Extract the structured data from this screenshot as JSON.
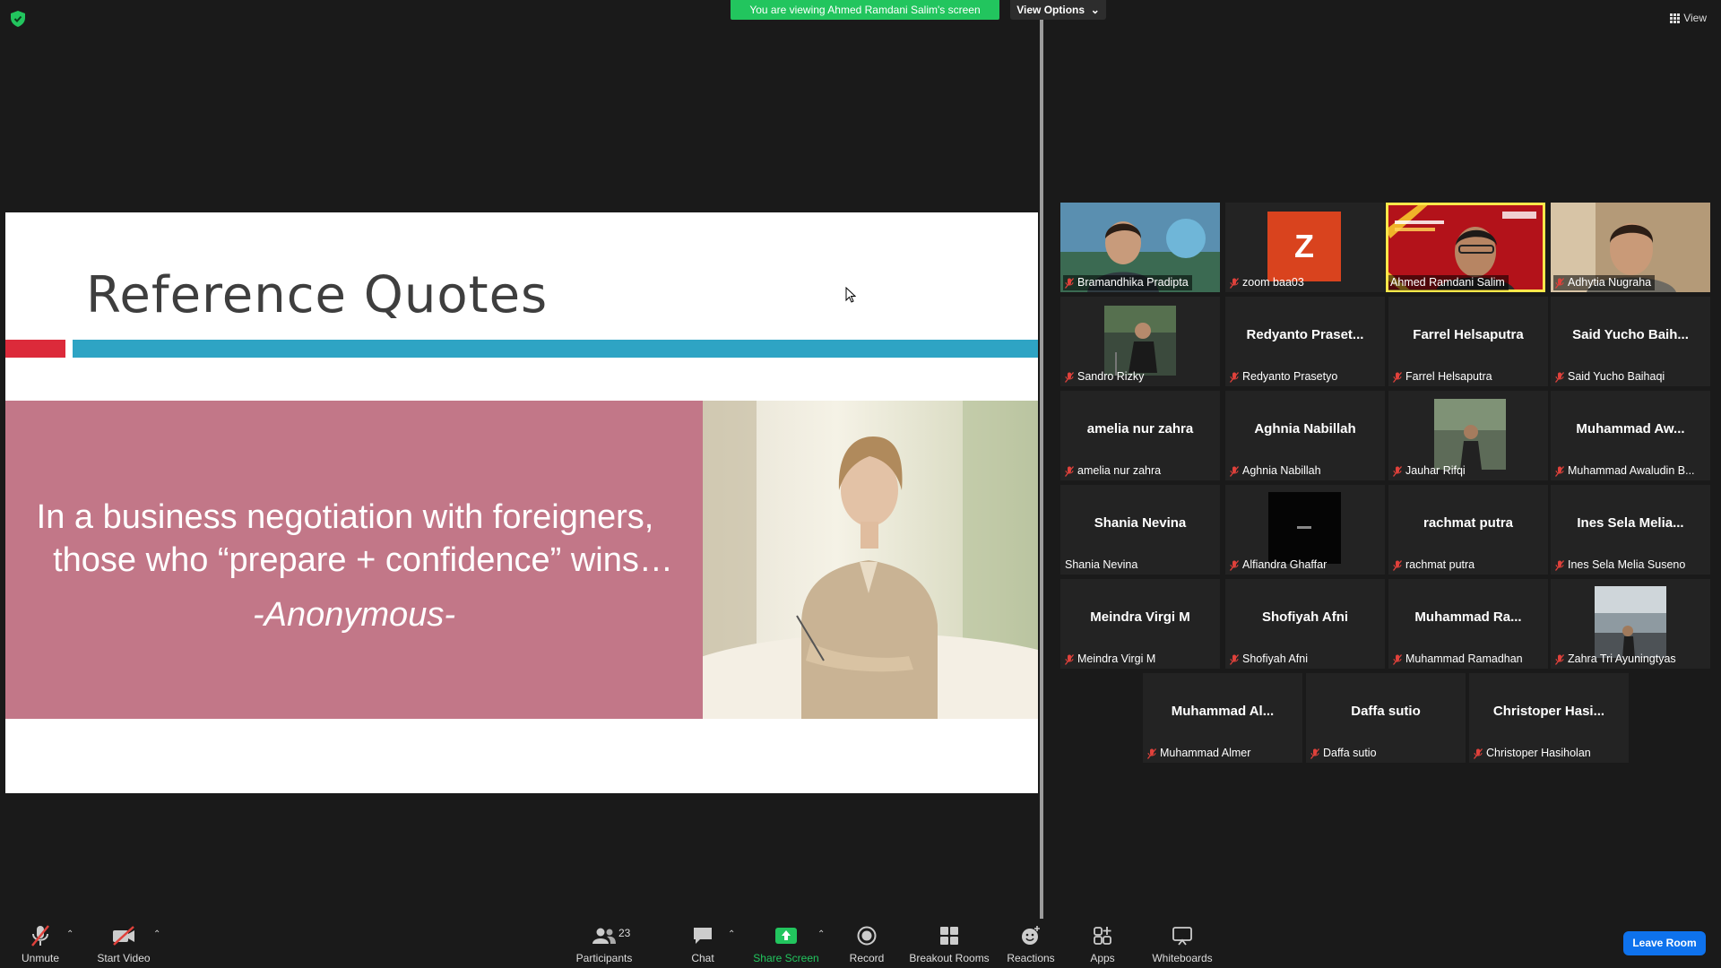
{
  "top_bar": {
    "viewing_banner": "You are viewing Ahmed Ramdani Salim's screen",
    "view_options_label": "View Options",
    "view_label": "View"
  },
  "slide": {
    "title": "Reference Quotes",
    "quote_line1": "In a business negotiation with foreigners,",
    "quote_line2": "those who “prepare + confidence” wins…",
    "quote_author": "-Anonymous-",
    "colors": {
      "red_bar": "#dc2a3a",
      "blue_bar": "#2ea4c4",
      "quote_panel": "#c27788"
    }
  },
  "gallery": {
    "active_speaker": "Ahmed Ramdani Salim",
    "rows": [
      [
        {
          "tile_name": "",
          "label": "Bramandhika Pradipta",
          "media": "video"
        },
        {
          "tile_name": "",
          "label": "zoom baa03",
          "media": "avatar",
          "avatar_letter": "Z"
        },
        {
          "tile_name": "",
          "label": "Ahmed Ramdani Salim",
          "media": "video"
        },
        {
          "tile_name": "",
          "label": "Adhytia Nugraha",
          "media": "video"
        }
      ],
      [
        {
          "tile_name": "",
          "label": "Sandro Rizky",
          "media": "photo"
        },
        {
          "tile_name": "Redyanto Praset...",
          "label": "Redyanto Prasetyo",
          "media": "name"
        },
        {
          "tile_name": "Farrel Helsaputra",
          "label": "Farrel Helsaputra",
          "media": "name"
        },
        {
          "tile_name": "Said Yucho Baih...",
          "label": "Said Yucho Baihaqi",
          "media": "name"
        }
      ],
      [
        {
          "tile_name": "amelia nur zahra",
          "label": "amelia nur zahra",
          "media": "name"
        },
        {
          "tile_name": "Aghnia Nabillah",
          "label": "Aghnia Nabillah",
          "media": "name"
        },
        {
          "tile_name": "",
          "label": "Jauhar Rifqi",
          "media": "photo"
        },
        {
          "tile_name": "Muhammad Aw...",
          "label": "Muhammad Awaludin B...",
          "media": "name"
        }
      ],
      [
        {
          "tile_name": "Shania Nevina",
          "label": "Shania Nevina",
          "media": "name"
        },
        {
          "tile_name": "",
          "label": "Alfiandra Ghaffar",
          "media": "photo"
        },
        {
          "tile_name": "rachmat putra",
          "label": "rachmat putra",
          "media": "name"
        },
        {
          "tile_name": "Ines Sela Melia...",
          "label": "Ines Sela Melia Suseno",
          "media": "name"
        }
      ],
      [
        {
          "tile_name": "Meindra Virgi M",
          "label": "Meindra Virgi M",
          "media": "name"
        },
        {
          "tile_name": "Shofiyah Afni",
          "label": "Shofiyah Afni",
          "media": "name"
        },
        {
          "tile_name": "Muhammad Ra...",
          "label": "Muhammad Ramadhan",
          "media": "name"
        },
        {
          "tile_name": "",
          "label": "Zahra Tri Ayuningtyas",
          "media": "photo"
        }
      ],
      [
        {
          "tile_name": "Muhammad Al...",
          "label": "Muhammad Almer",
          "media": "name"
        },
        {
          "tile_name": "Daffa sutio",
          "label": "Daffa sutio",
          "media": "name"
        },
        {
          "tile_name": "Christoper Hasi...",
          "label": "Christoper Hasiholan",
          "media": "name"
        }
      ]
    ]
  },
  "toolbar": {
    "unmute_label": "Unmute",
    "start_video_label": "Start Video",
    "participants_label": "Participants",
    "participants_count": "23",
    "chat_label": "Chat",
    "share_screen_label": "Share Screen",
    "record_label": "Record",
    "breakout_rooms_label": "Breakout Rooms",
    "reactions_label": "Reactions",
    "apps_label": "Apps",
    "whiteboards_label": "Whiteboards",
    "leave_label": "Leave Room",
    "colors": {
      "share_green": "#22c55e",
      "leave_blue": "#0e72ed",
      "muted_red": "#e0413b"
    }
  }
}
